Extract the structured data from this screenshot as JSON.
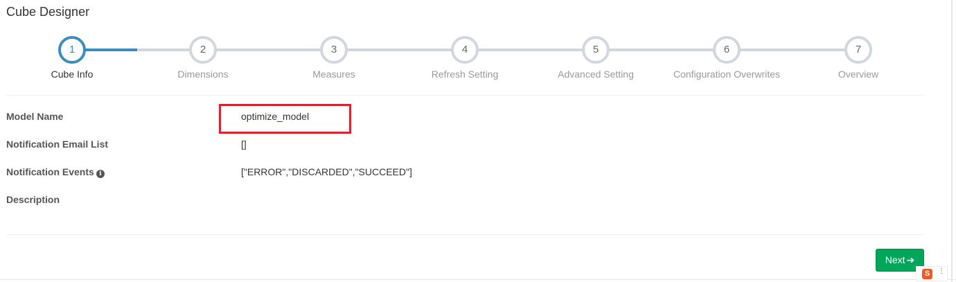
{
  "page": {
    "title": "Cube Designer"
  },
  "wizard": {
    "steps": [
      {
        "number": "1",
        "label": "Cube Info",
        "active": true
      },
      {
        "number": "2",
        "label": "Dimensions",
        "active": false
      },
      {
        "number": "3",
        "label": "Measures",
        "active": false
      },
      {
        "number": "4",
        "label": "Refresh Setting",
        "active": false
      },
      {
        "number": "5",
        "label": "Advanced Setting",
        "active": false
      },
      {
        "number": "6",
        "label": "Configuration Overwrites",
        "active": false
      },
      {
        "number": "7",
        "label": "Overview",
        "active": false
      }
    ],
    "colors": {
      "active": "#3c8dbc",
      "inactive": "#d2d6de"
    }
  },
  "form": {
    "model_name": {
      "label": "Model Name",
      "value": "optimize_model"
    },
    "notification_email": {
      "label": "Notification Email List",
      "value": "[]"
    },
    "notification_events": {
      "label": "Notification Events",
      "value": "[\"ERROR\",\"DISCARDED\",\"SUCCEED\"]",
      "icon": "info-circle-icon"
    },
    "description": {
      "label": "Description",
      "value": ""
    }
  },
  "actions": {
    "next_label": "Next",
    "next_icon": "arrow-right-icon",
    "next_color": "#00a65a"
  },
  "annotation": {
    "highlight_color": "#d9232e"
  },
  "widget": {
    "logo_text": "S",
    "caret": "⋮"
  }
}
